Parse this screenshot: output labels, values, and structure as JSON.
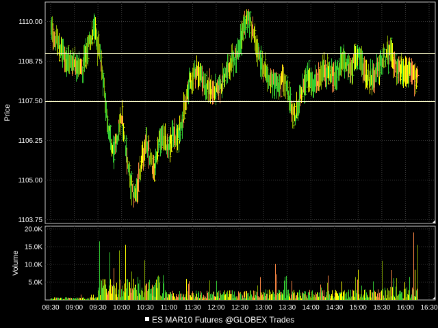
{
  "chart_data": [
    {
      "type": "bar",
      "panel": "price",
      "ylabel": "Price",
      "ylim": [
        1103.75,
        1110.75
      ],
      "y_ticks": [
        "1110.00",
        "1108.75",
        "1107.50",
        "1106.25",
        "1105.00",
        "1103.75"
      ],
      "x_ticks": [
        "08:30",
        "09:00",
        "09:30",
        "10:00",
        "10:30",
        "11:00",
        "11:30",
        "12:00",
        "12:30",
        "13:00",
        "13:30",
        "14:00",
        "14:30",
        "15:00",
        "15:30",
        "16:00",
        "16:30"
      ],
      "grid": true,
      "reference_lines": [
        1109.0,
        1107.5
      ],
      "colors": {
        "up": "#33cc33",
        "down": "#ff8844",
        "neutral": "#ffff00",
        "dark": "#88aa00",
        "reference": "#ffffcc"
      },
      "anchors": [
        {
          "t": "08:30",
          "p": 1109.75
        },
        {
          "t": "08:40",
          "p": 1109.25
        },
        {
          "t": "08:50",
          "p": 1108.75
        },
        {
          "t": "09:00",
          "p": 1108.75
        },
        {
          "t": "09:10",
          "p": 1108.5
        },
        {
          "t": "09:20",
          "p": 1109.5
        },
        {
          "t": "09:25",
          "p": 1109.75
        },
        {
          "t": "09:35",
          "p": 1108.5
        },
        {
          "t": "09:40",
          "p": 1107.25
        },
        {
          "t": "09:45",
          "p": 1106.25
        },
        {
          "t": "09:50",
          "p": 1105.75
        },
        {
          "t": "09:55",
          "p": 1106.5
        },
        {
          "t": "10:00",
          "p": 1107.0
        },
        {
          "t": "10:05",
          "p": 1106.0
        },
        {
          "t": "10:10",
          "p": 1105.0
        },
        {
          "t": "10:15",
          "p": 1104.5
        },
        {
          "t": "10:20",
          "p": 1104.75
        },
        {
          "t": "10:25",
          "p": 1105.5
        },
        {
          "t": "10:30",
          "p": 1106.25
        },
        {
          "t": "10:35",
          "p": 1105.75
        },
        {
          "t": "10:40",
          "p": 1105.25
        },
        {
          "t": "10:45",
          "p": 1106.0
        },
        {
          "t": "10:50",
          "p": 1106.5
        },
        {
          "t": "10:55",
          "p": 1106.25
        },
        {
          "t": "11:00",
          "p": 1106.0
        },
        {
          "t": "11:05",
          "p": 1106.5
        },
        {
          "t": "11:10",
          "p": 1106.25
        },
        {
          "t": "11:20",
          "p": 1107.25
        },
        {
          "t": "11:25",
          "p": 1108.0
        },
        {
          "t": "11:35",
          "p": 1108.5
        },
        {
          "t": "11:45",
          "p": 1108.0
        },
        {
          "t": "12:00",
          "p": 1107.75
        },
        {
          "t": "12:10",
          "p": 1108.25
        },
        {
          "t": "12:20",
          "p": 1108.75
        },
        {
          "t": "12:30",
          "p": 1109.25
        },
        {
          "t": "12:40",
          "p": 1110.25
        },
        {
          "t": "12:45",
          "p": 1109.75
        },
        {
          "t": "12:55",
          "p": 1108.75
        },
        {
          "t": "13:05",
          "p": 1108.25
        },
        {
          "t": "13:15",
          "p": 1108.0
        },
        {
          "t": "13:25",
          "p": 1108.25
        },
        {
          "t": "13:35",
          "p": 1107.25
        },
        {
          "t": "13:40",
          "p": 1107.0
        },
        {
          "t": "13:45",
          "p": 1107.5
        },
        {
          "t": "13:55",
          "p": 1108.25
        },
        {
          "t": "14:05",
          "p": 1108.0
        },
        {
          "t": "14:15",
          "p": 1108.5
        },
        {
          "t": "14:30",
          "p": 1108.25
        },
        {
          "t": "14:40",
          "p": 1108.75
        },
        {
          "t": "14:50",
          "p": 1108.5
        },
        {
          "t": "15:00",
          "p": 1109.0
        },
        {
          "t": "15:10",
          "p": 1108.25
        },
        {
          "t": "15:20",
          "p": 1108.25
        },
        {
          "t": "15:30",
          "p": 1108.75
        },
        {
          "t": "15:40",
          "p": 1109.0
        },
        {
          "t": "15:50",
          "p": 1108.5
        },
        {
          "t": "16:00",
          "p": 1108.5
        },
        {
          "t": "16:10",
          "p": 1108.25
        },
        {
          "t": "16:15",
          "p": 1108.25
        }
      ]
    },
    {
      "type": "bar",
      "panel": "volume",
      "ylabel": "Volume",
      "ylim": [
        0,
        20000
      ],
      "y_ticks": [
        "20.0K",
        "15.0K",
        "10.0K",
        "5.0K"
      ],
      "x_ticks": [
        "08:30",
        "09:00",
        "09:30",
        "10:00",
        "10:30",
        "11:00",
        "11:30",
        "12:00",
        "12:30",
        "13:00",
        "13:30",
        "14:00",
        "14:30",
        "15:00",
        "15:30",
        "16:00",
        "16:30"
      ],
      "grid": true,
      "colors": {
        "up": "#33cc33",
        "down": "#ff8844",
        "neutral": "#ffff00",
        "dark": "#88aa00"
      },
      "spikes": [
        {
          "t": "09:32",
          "v": 16500
        },
        {
          "t": "09:50",
          "v": 9000
        },
        {
          "t": "10:05",
          "v": 15500
        },
        {
          "t": "10:12",
          "v": 8000
        },
        {
          "t": "10:20",
          "v": 6500
        },
        {
          "t": "13:15",
          "v": 10200
        },
        {
          "t": "15:00",
          "v": 8500
        },
        {
          "t": "15:30",
          "v": 11000
        },
        {
          "t": "16:05",
          "v": 6500
        },
        {
          "t": "16:10",
          "v": 19000
        },
        {
          "t": "16:12",
          "v": 8500
        },
        {
          "t": "16:15",
          "v": 15500
        }
      ],
      "baseline_pattern": [
        {
          "from": "08:30",
          "to": "09:30",
          "v": 600
        },
        {
          "from": "09:30",
          "to": "10:45",
          "v": 4800
        },
        {
          "from": "10:45",
          "to": "13:00",
          "v": 2200
        },
        {
          "from": "13:00",
          "to": "15:30",
          "v": 2400
        },
        {
          "from": "15:30",
          "to": "16:15",
          "v": 3000
        }
      ]
    }
  ],
  "legend": {
    "label": "ES MAR10 Futures @GLOBEX Trades",
    "position": "bottom-center"
  }
}
